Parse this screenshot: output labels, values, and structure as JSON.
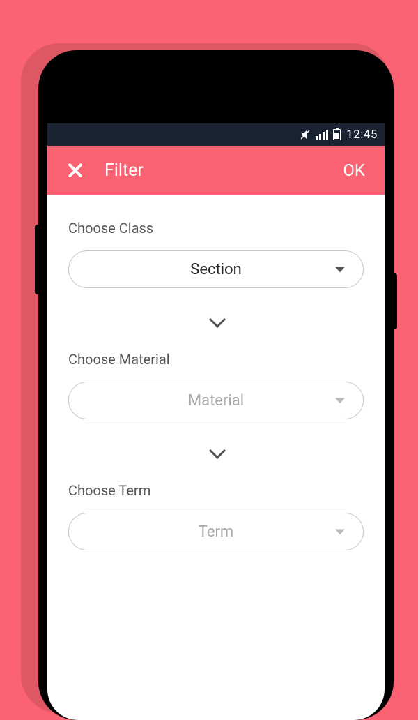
{
  "statusBar": {
    "time": "12:45"
  },
  "header": {
    "title": "Filter",
    "okLabel": "OK"
  },
  "fields": {
    "class": {
      "label": "Choose Class",
      "value": "Section"
    },
    "material": {
      "label": "Choose Material",
      "value": "Material"
    },
    "term": {
      "label": "Choose Term",
      "value": "Term"
    }
  }
}
